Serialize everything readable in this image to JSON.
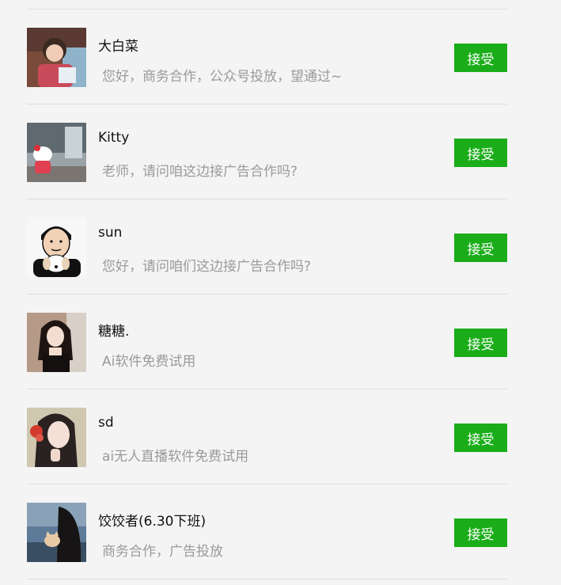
{
  "requests": [
    {
      "name": "大白菜",
      "message": "您好，商务合作，公众号投放，望通过~",
      "button": "接受",
      "avatar_icon": "girl-photo-avatar"
    },
    {
      "name": "Kitty",
      "message": "老师，请问咱这边接广告合作吗?",
      "button": "接受",
      "avatar_icon": "hello-kitty-avatar"
    },
    {
      "name": "sun",
      "message": "您好，请问咱们这边接广告合作吗?",
      "button": "接受",
      "avatar_icon": "cartoon-man-dog-avatar"
    },
    {
      "name": "糖糖.",
      "message": "Ai软件免费试用",
      "button": "接受",
      "avatar_icon": "woman-portrait-avatar"
    },
    {
      "name": "sd",
      "message": "ai无人直播软件免费试用",
      "button": "接受",
      "avatar_icon": "girl-flower-avatar"
    },
    {
      "name": "饺饺者(6.30下班)",
      "message": "商务合作，广告投放",
      "button": "接受",
      "avatar_icon": "woman-cat-sea-avatar"
    }
  ],
  "colors": {
    "accept_button": "#1aad19",
    "background": "#f4f4f4",
    "message_text": "#9a9a9a"
  }
}
